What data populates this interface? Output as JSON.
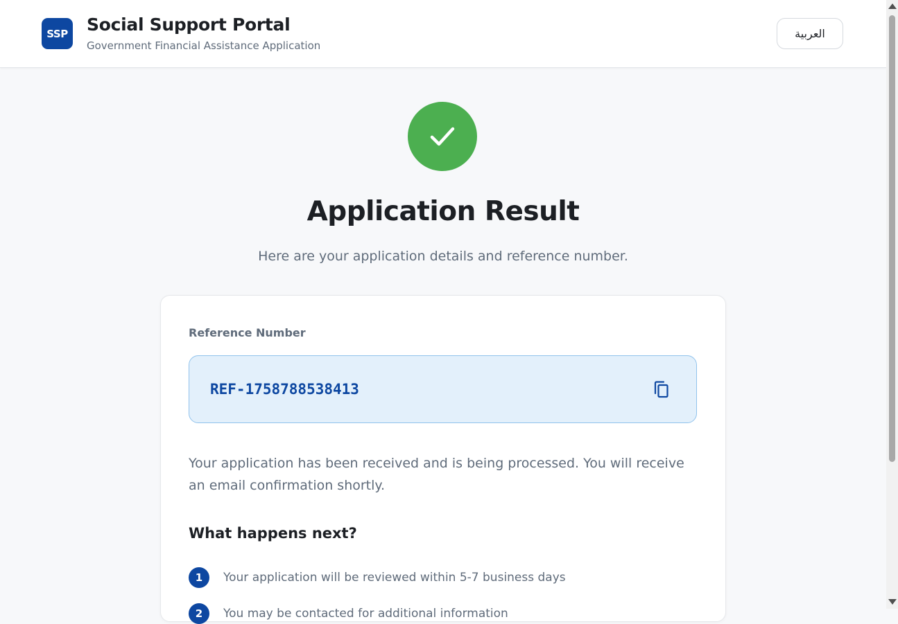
{
  "header": {
    "logo_text": "SSP",
    "title": "Social Support Portal",
    "subtitle": "Government Financial Assistance Application",
    "language_button": "العربية"
  },
  "main": {
    "icon": "check-icon",
    "title": "Application Result",
    "subtitle": "Here are your application details and reference number.",
    "card": {
      "reference_label": "Reference Number",
      "reference_value": "REF-1758788538413",
      "copy_icon": "copy-icon",
      "message": "Your application has been received and is being processed. You will receive an email confirmation shortly.",
      "next_heading": "What happens next?",
      "steps": [
        {
          "number": "1",
          "text": "Your application will be reviewed within 5-7 business days"
        },
        {
          "number": "2",
          "text": "You may be contacted for additional information"
        }
      ]
    }
  },
  "colors": {
    "brand": "#0d47a1",
    "success": "#4caf50",
    "reference_bg": "#e3f0fb"
  }
}
